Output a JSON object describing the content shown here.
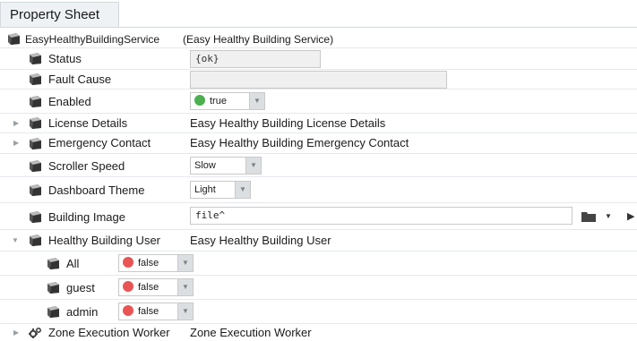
{
  "tab": {
    "title": "Property Sheet"
  },
  "root": {
    "name": "EasyHealthyBuildingService",
    "display": "(Easy Healthy Building Service)"
  },
  "rows": {
    "status": {
      "label": "Status",
      "value": "{ok}"
    },
    "fault_cause": {
      "label": "Fault Cause",
      "value": ""
    },
    "enabled": {
      "label": "Enabled",
      "value": "true",
      "color": "#4caf50"
    },
    "license_details": {
      "label": "License Details",
      "value": "Easy Healthy Building License Details"
    },
    "emergency_contact": {
      "label": "Emergency Contact",
      "value": "Easy Healthy Building Emergency Contact"
    },
    "scroller_speed": {
      "label": "Scroller Speed",
      "value": "Slow"
    },
    "dashboard_theme": {
      "label": "Dashboard Theme",
      "value": "Light"
    },
    "building_image": {
      "label": "Building Image",
      "value": "file^"
    },
    "healthy_building_user": {
      "label": "Healthy Building User",
      "value": "Easy Healthy Building User"
    },
    "all": {
      "label": "All",
      "value": "false",
      "color": "#e95454"
    },
    "guest": {
      "label": "guest",
      "value": "false",
      "color": "#e95454"
    },
    "admin": {
      "label": "admin",
      "value": "false",
      "color": "#e95454"
    },
    "zone_execution_worker": {
      "label": "Zone Execution Worker",
      "value": "Zone Execution Worker"
    }
  },
  "icons": {
    "property": "slot-icon",
    "expand": "triangle-right-icon",
    "collapse": "triangle-down-icon",
    "worker": "gears-icon",
    "folder": "folder-icon"
  }
}
